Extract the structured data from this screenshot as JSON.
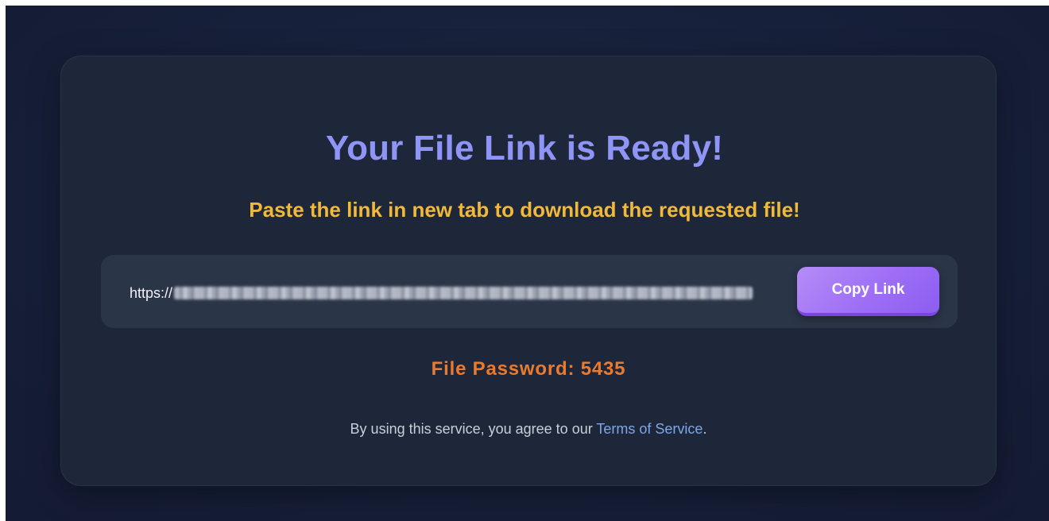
{
  "heading": {
    "title": "Your File Link is Ready!",
    "subtitle": "Paste the link in new tab to download the requested file!"
  },
  "link": {
    "prefix": "https://",
    "copy_button_label": "Copy Link"
  },
  "password": {
    "text": "File Password: 5435"
  },
  "footer": {
    "prefix": "By using this service, you agree to our ",
    "terms_link": "Terms of Service",
    "suffix": "."
  },
  "colors": {
    "background": "#17203a",
    "card": "#1e2739",
    "title": "#8f94f7",
    "subtitle": "#f0b93a",
    "password": "#ec7a2d",
    "button": "#9d6ef5",
    "link": "#7fa6e6"
  }
}
